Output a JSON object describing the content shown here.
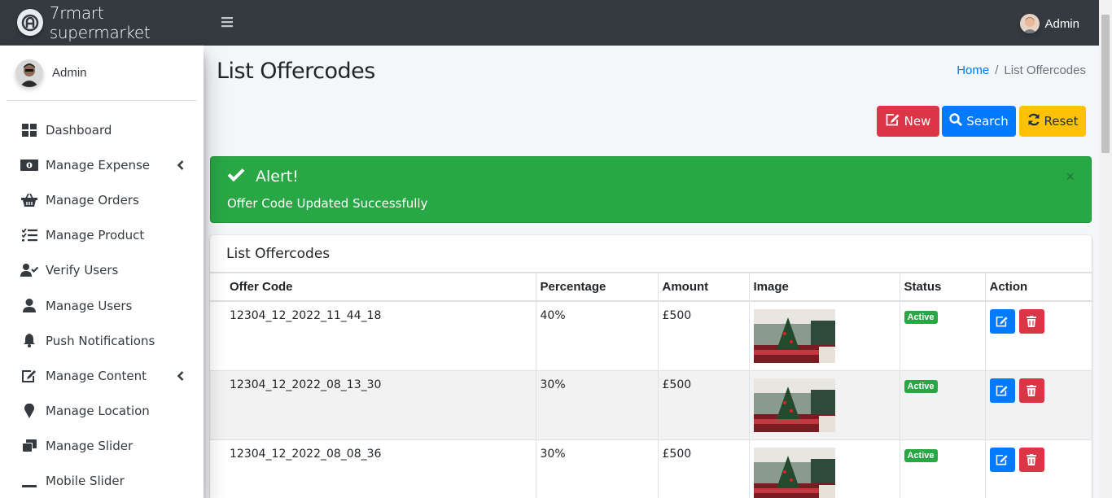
{
  "brand": {
    "name": "7rmart supermarket"
  },
  "sidebar": {
    "user_name": "Admin",
    "items": [
      {
        "label": "Dashboard",
        "icon": "dashboard-icon",
        "has_submenu": false
      },
      {
        "label": "Manage Expense",
        "icon": "money-icon",
        "has_submenu": true
      },
      {
        "label": "Manage Orders",
        "icon": "basket-icon",
        "has_submenu": false
      },
      {
        "label": "Manage Product",
        "icon": "list-check-icon",
        "has_submenu": false
      },
      {
        "label": "Verify Users",
        "icon": "user-check-icon",
        "has_submenu": false
      },
      {
        "label": "Manage Users",
        "icon": "user-icon",
        "has_submenu": false
      },
      {
        "label": "Push Notifications",
        "icon": "bell-icon",
        "has_submenu": false
      },
      {
        "label": "Manage Content",
        "icon": "edit-icon",
        "has_submenu": true
      },
      {
        "label": "Manage Location",
        "icon": "map-marker-icon",
        "has_submenu": false
      },
      {
        "label": "Manage Slider",
        "icon": "slides-icon",
        "has_submenu": false
      },
      {
        "label": "Mobile Slider",
        "icon": "minus-icon",
        "has_submenu": false
      }
    ]
  },
  "topbar": {
    "user_name": "Admin"
  },
  "page": {
    "title": "List Offercodes",
    "breadcrumb": {
      "home": "Home",
      "separator": "/",
      "current": "List Offercodes"
    }
  },
  "buttons": {
    "new": "New",
    "search": "Search",
    "reset": "Reset"
  },
  "alert": {
    "title": "Alert!",
    "message": "Offer Code Updated Successfully",
    "close": "×"
  },
  "table": {
    "card_title": "List Offercodes",
    "headers": [
      "Offer Code",
      "Percentage",
      "Amount",
      "Image",
      "Status",
      "Action"
    ],
    "rows": [
      {
        "offer_code": "12304_12_2022_11_44_18",
        "percentage": "40%",
        "amount": "£500",
        "status": "Active"
      },
      {
        "offer_code": "12304_12_2022_08_13_30",
        "percentage": "30%",
        "amount": "£500",
        "status": "Active"
      },
      {
        "offer_code": "12304_12_2022_08_08_36",
        "percentage": "30%",
        "amount": "£500",
        "status": "Active"
      }
    ]
  },
  "colors": {
    "sidebar_dark": "#343a40",
    "primary": "#007bff",
    "danger": "#dc3545",
    "warning": "#ffc107",
    "success": "#28a745"
  }
}
